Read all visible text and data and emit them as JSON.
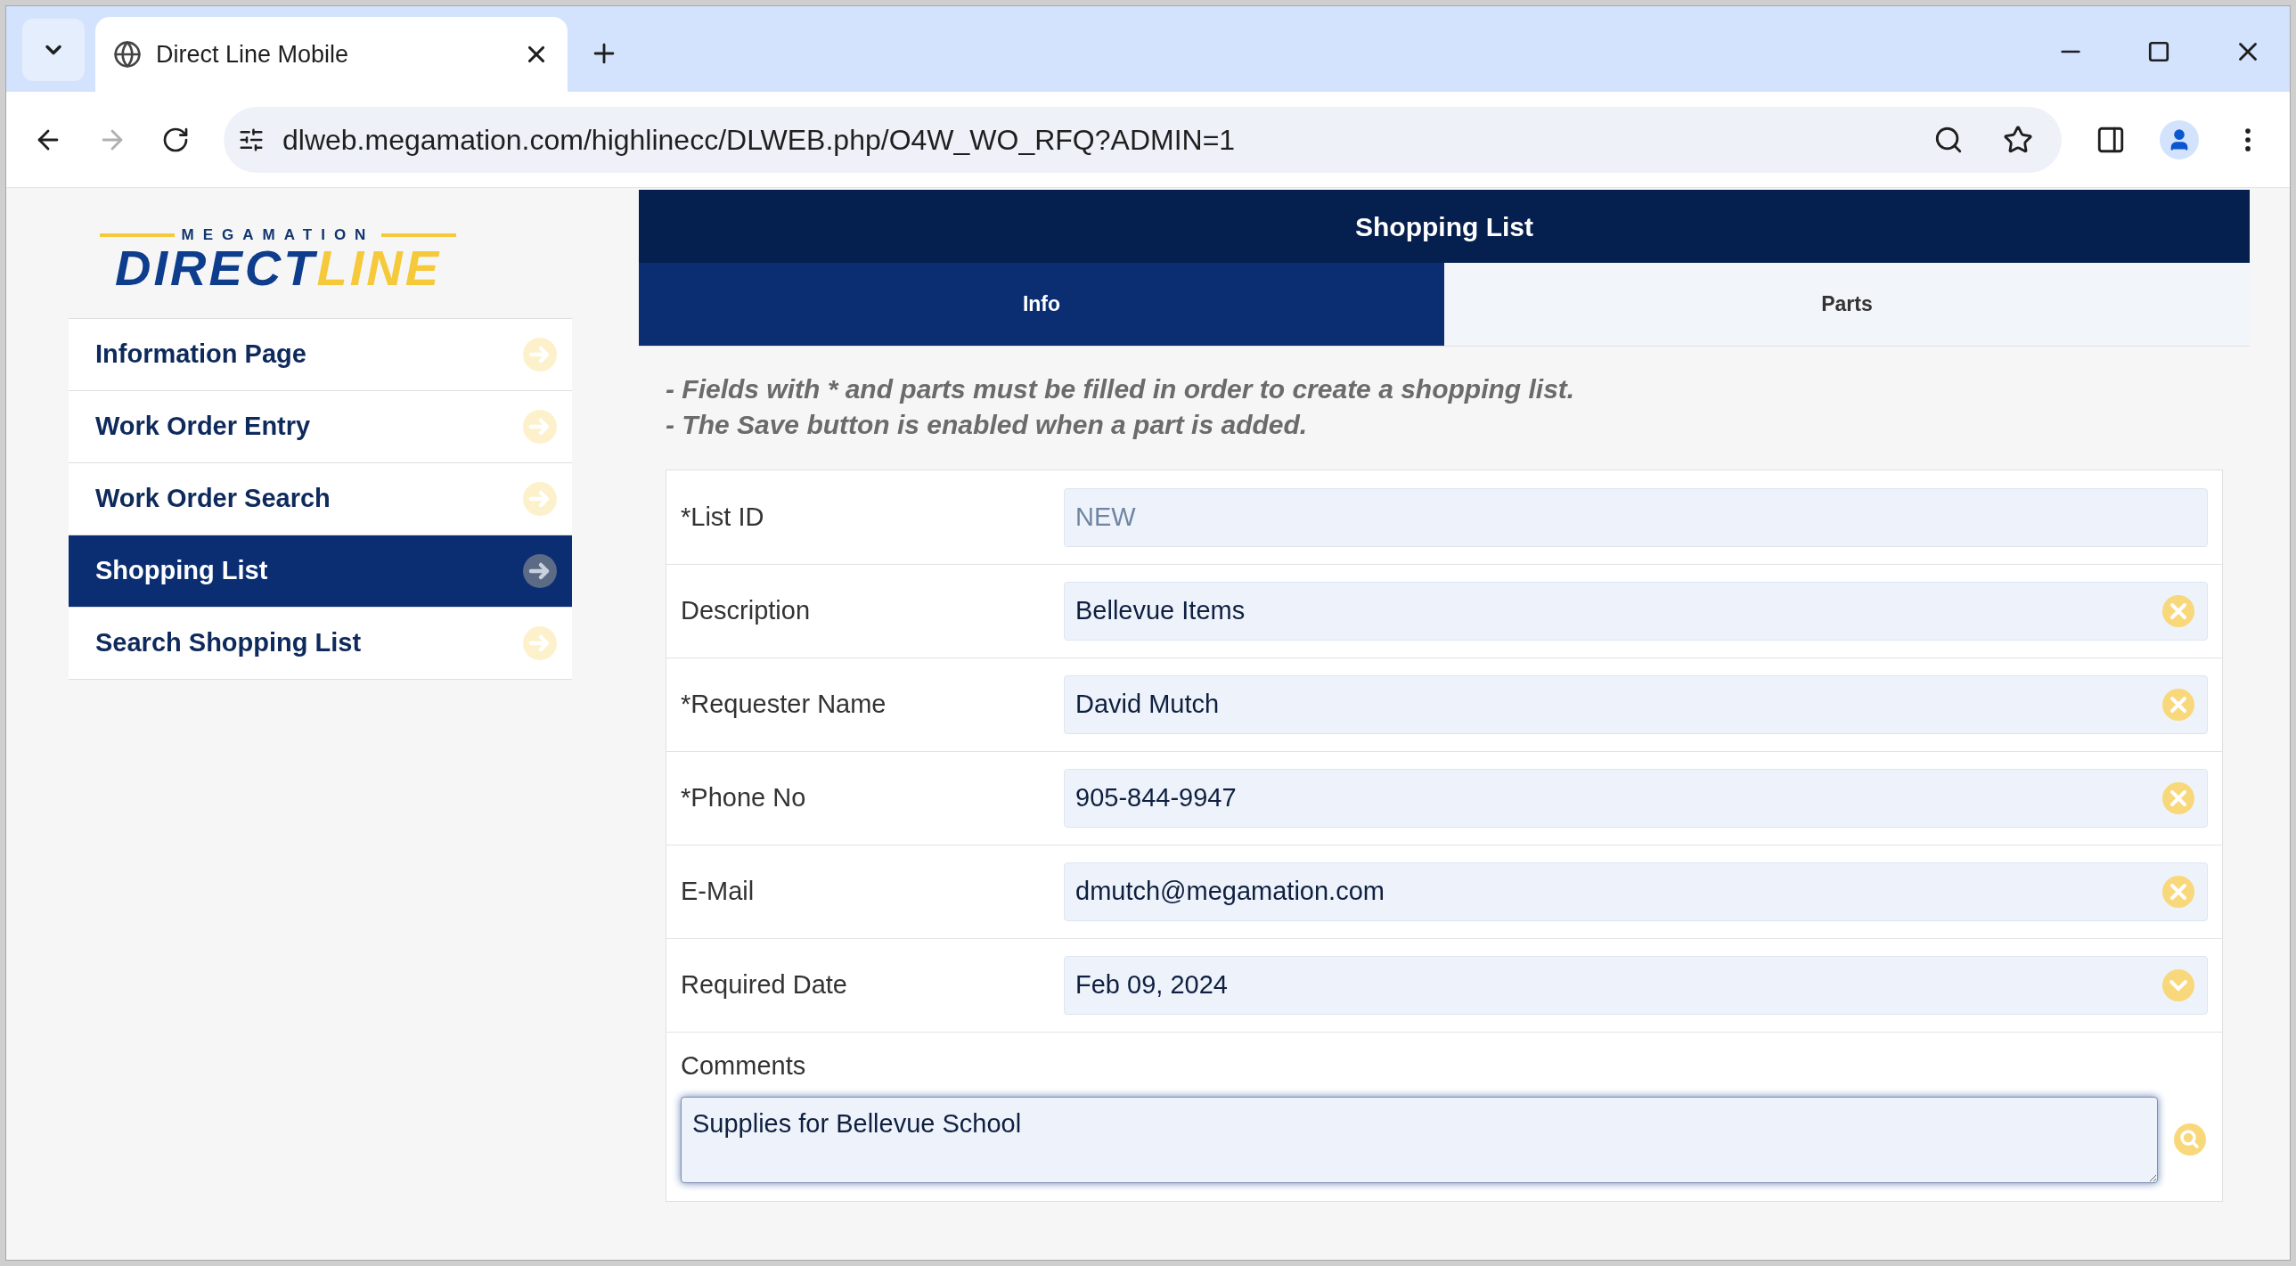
{
  "browser": {
    "tab_title": "Direct Line Mobile",
    "url": "dlweb.megamation.com/highlinecc/DLWEB.php/O4W_WO_RFQ?ADMIN=1"
  },
  "logo": {
    "top": "MEGAMATION",
    "left_part": "DIRECT",
    "right_part": "LINE"
  },
  "sidebar": {
    "items": [
      {
        "label": "Information Page",
        "selected": false
      },
      {
        "label": "Work Order Entry",
        "selected": false
      },
      {
        "label": "Work Order Search",
        "selected": false
      },
      {
        "label": "Shopping List",
        "selected": true
      },
      {
        "label": "Search Shopping List",
        "selected": false
      }
    ]
  },
  "panel": {
    "title": "Shopping List",
    "tabs": [
      {
        "label": "Info",
        "selected": true
      },
      {
        "label": "Parts",
        "selected": false
      }
    ],
    "notes": [
      "- Fields with * and parts must be filled in order to create a shopping list.",
      "- The Save button is enabled when a part is added."
    ],
    "fields": [
      {
        "label": "*List ID",
        "kind": "readonly",
        "value": "NEW"
      },
      {
        "label": "Description",
        "kind": "text",
        "value": "Bellevue Items"
      },
      {
        "label": "*Requester Name",
        "kind": "text",
        "value": "David Mutch"
      },
      {
        "label": "*Phone No",
        "kind": "text",
        "value": "905-844-9947"
      },
      {
        "label": "E-Mail",
        "kind": "text",
        "value": "dmutch@megamation.com"
      },
      {
        "label": "Required Date",
        "kind": "date",
        "value": "Feb 09, 2024"
      },
      {
        "label": "Comments",
        "kind": "textarea",
        "value": "Supplies for Bellevue School"
      }
    ]
  }
}
